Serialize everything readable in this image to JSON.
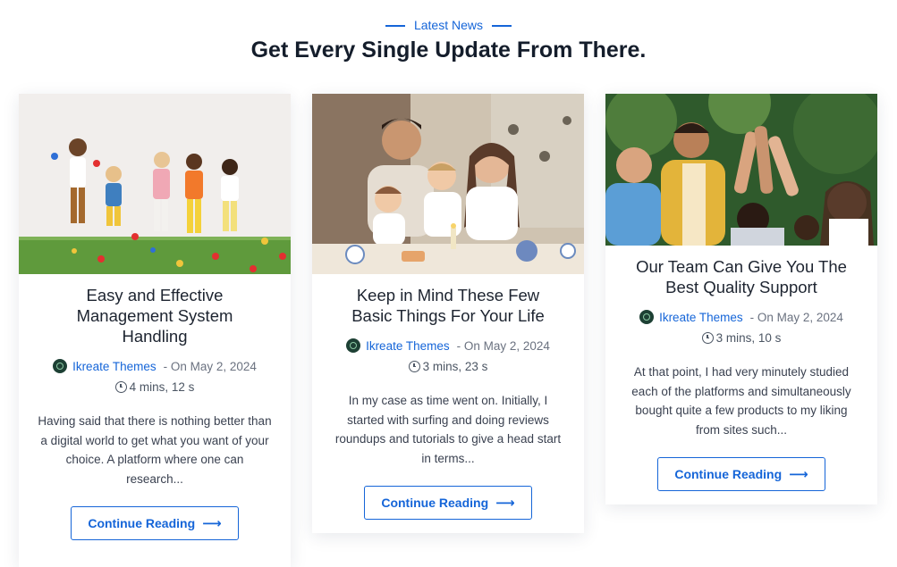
{
  "section": {
    "eyebrow": "Latest News",
    "headline": "Get Every Single Update From There."
  },
  "colors": {
    "accent": "#1565d8",
    "heading": "#141d2b",
    "text": "#3a4150"
  },
  "icons": {
    "author_logo": "ikreate-logo-icon",
    "time": "clock-icon",
    "button_arrow": "arrow-right-icon"
  },
  "posts": [
    {
      "title": "Easy and Effective Management System Handling",
      "author": "Ikreate Themes",
      "date": "- On May 2, 2024",
      "read_time": "4 mins, 12 s",
      "excerpt": "Having said that there is nothing better than a digital world to get what you want of your choice. A platform where one can research...",
      "cta": "Continue Reading",
      "image": "children-playing-with-balls-photo"
    },
    {
      "title": "Keep in Mind These Few Basic Things For Your Life",
      "author": "Ikreate Themes",
      "date": "- On May 2, 2024",
      "read_time": "3 mins, 23 s",
      "excerpt": "In my case as time went on. Initially, I started with surfing and doing reviews roundups and tutorials to give a head start in terms...",
      "cta": "Continue Reading",
      "image": "family-at-table-photo"
    },
    {
      "title": "Our Team Can Give You The Best Quality Support",
      "author": "Ikreate Themes",
      "date": "- On May 2, 2024",
      "read_time": "3 mins, 10 s",
      "excerpt": "At that point, I had very minutely studied each of the platforms and simultaneously bought quite a few products to my liking from sites such...",
      "cta": "Continue Reading",
      "image": "team-high-five-photo"
    }
  ]
}
